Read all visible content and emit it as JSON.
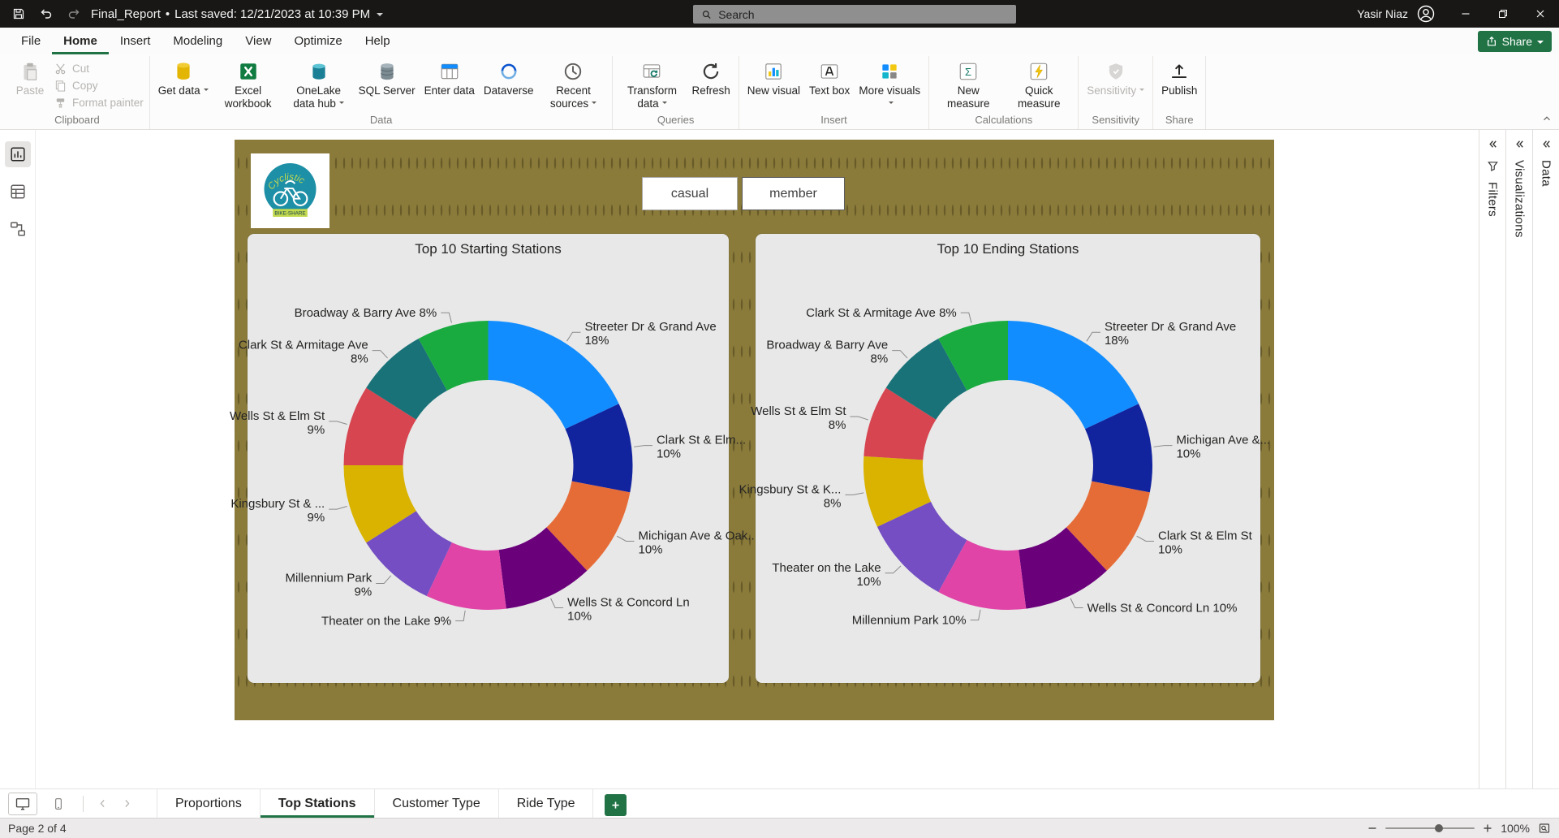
{
  "theme": {
    "titlebar_bg": "#181716",
    "accent": "#217346",
    "canvas_olive": "#8a7b3b",
    "panel_bg": "#e8e8e8"
  },
  "titlebar": {
    "title": "Final_Report",
    "bullet": "•",
    "last_saved": "Last saved: 12/21/2023 at 10:39 PM",
    "search_placeholder": "Search",
    "user_name": "Yasir Niaz"
  },
  "menu": {
    "items": [
      "File",
      "Home",
      "Insert",
      "Modeling",
      "View",
      "Optimize",
      "Help"
    ],
    "share_label": "Share"
  },
  "ribbon": {
    "groups": [
      {
        "label": "Clipboard",
        "items": [
          {
            "label": "Paste"
          },
          {
            "label": "Cut"
          },
          {
            "label": "Copy"
          },
          {
            "label": "Format painter"
          }
        ]
      },
      {
        "label": "Data",
        "items": [
          {
            "label": "Get data"
          },
          {
            "label": "Excel workbook"
          },
          {
            "label": "OneLake data hub"
          },
          {
            "label": "SQL Server"
          },
          {
            "label": "Enter data"
          },
          {
            "label": "Dataverse"
          },
          {
            "label": "Recent sources"
          }
        ]
      },
      {
        "label": "Queries",
        "items": [
          {
            "label": "Transform data"
          },
          {
            "label": "Refresh"
          }
        ]
      },
      {
        "label": "Insert",
        "items": [
          {
            "label": "New visual"
          },
          {
            "label": "Text box"
          },
          {
            "label": "More visuals"
          }
        ]
      },
      {
        "label": "Calculations",
        "items": [
          {
            "label": "New measure"
          },
          {
            "label": "Quick measure"
          }
        ]
      },
      {
        "label": "Sensitivity",
        "items": [
          {
            "label": "Sensitivity"
          }
        ]
      },
      {
        "label": "Share",
        "items": [
          {
            "label": "Publish"
          }
        ]
      }
    ]
  },
  "logo": {
    "brand": "Cyclistic",
    "tagline": "BIKE-SHARE"
  },
  "slicer_buttons": [
    "casual",
    "member"
  ],
  "panels_right": {
    "filters": "Filters",
    "visualizations": "Visualizations",
    "data": "Data"
  },
  "pages": {
    "tabs": [
      "Proportions",
      "Top Stations",
      "Customer Type",
      "Ride Type"
    ],
    "active": "Top Stations"
  },
  "statusbar": {
    "page_indicator": "Page 2 of 4",
    "zoom_level": "100%"
  },
  "chart_data": [
    {
      "type": "pie",
      "title": "Top 10 Starting Stations",
      "donut": true,
      "inner_radius_ratio": 0.59,
      "legend": "none",
      "colors": [
        "#118DFF",
        "#12239E",
        "#E66C37",
        "#6B007B",
        "#E044A7",
        "#744EC2",
        "#D9B300",
        "#D64550",
        "#197278",
        "#1AAB40"
      ],
      "slices": [
        {
          "name": "Streeter Dr & Grand Ave",
          "pct": 18,
          "two_line": true
        },
        {
          "name": "Clark St & Elm...",
          "pct": 10,
          "two_line": true
        },
        {
          "name": "Michigan Ave & Oak...",
          "pct": 10,
          "two_line": true
        },
        {
          "name": "Wells St & Concord Ln",
          "pct": 10,
          "two_line": true
        },
        {
          "name": "Theater on the Lake",
          "pct": 9,
          "two_line": false
        },
        {
          "name": "Millennium Park",
          "pct": 9,
          "two_line": true
        },
        {
          "name": "Kingsbury St & ...",
          "pct": 9,
          "two_line": true
        },
        {
          "name": "Wells St & Elm St",
          "pct": 9,
          "two_line": true
        },
        {
          "name": "Clark St & Armitage Ave",
          "pct": 8,
          "two_line": true
        },
        {
          "name": "Broadway & Barry Ave",
          "pct": 8,
          "two_line": false
        }
      ]
    },
    {
      "type": "pie",
      "title": "Top 10 Ending Stations",
      "donut": true,
      "inner_radius_ratio": 0.59,
      "legend": "none",
      "colors": [
        "#118DFF",
        "#12239E",
        "#E66C37",
        "#6B007B",
        "#E044A7",
        "#744EC2",
        "#D9B300",
        "#D64550",
        "#197278",
        "#1AAB40"
      ],
      "slices": [
        {
          "name": "Streeter Dr & Grand Ave",
          "pct": 18,
          "two_line": true
        },
        {
          "name": "Michigan Ave &...",
          "pct": 10,
          "two_line": true
        },
        {
          "name": "Clark St & Elm St",
          "pct": 10,
          "two_line": true
        },
        {
          "name": "Wells St & Concord Ln",
          "pct": 10,
          "two_line": false
        },
        {
          "name": "Millennium Park",
          "pct": 10,
          "two_line": false
        },
        {
          "name": "Theater on the Lake",
          "pct": 10,
          "two_line": true
        },
        {
          "name": "Kingsbury St & K...",
          "pct": 8,
          "two_line": true
        },
        {
          "name": "Wells St & Elm St",
          "pct": 8,
          "two_line": true
        },
        {
          "name": "Broadway & Barry Ave",
          "pct": 8,
          "two_line": true
        },
        {
          "name": "Clark St & Armitage Ave",
          "pct": 8,
          "two_line": false
        }
      ]
    }
  ]
}
